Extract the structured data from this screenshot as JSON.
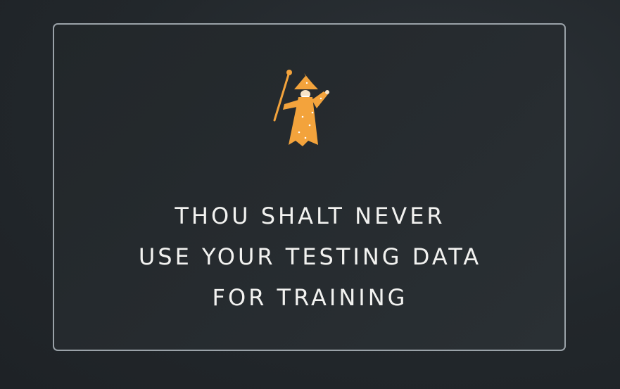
{
  "slide": {
    "icon": "wizard-icon",
    "lines": [
      "THOU SHALT NEVER",
      "USE YOUR TESTING DATA",
      "FOR TRAINING"
    ]
  },
  "colors": {
    "wizard_orange": "#f3a33c",
    "text": "#f2f2f0",
    "border": "#9aa2a8"
  }
}
